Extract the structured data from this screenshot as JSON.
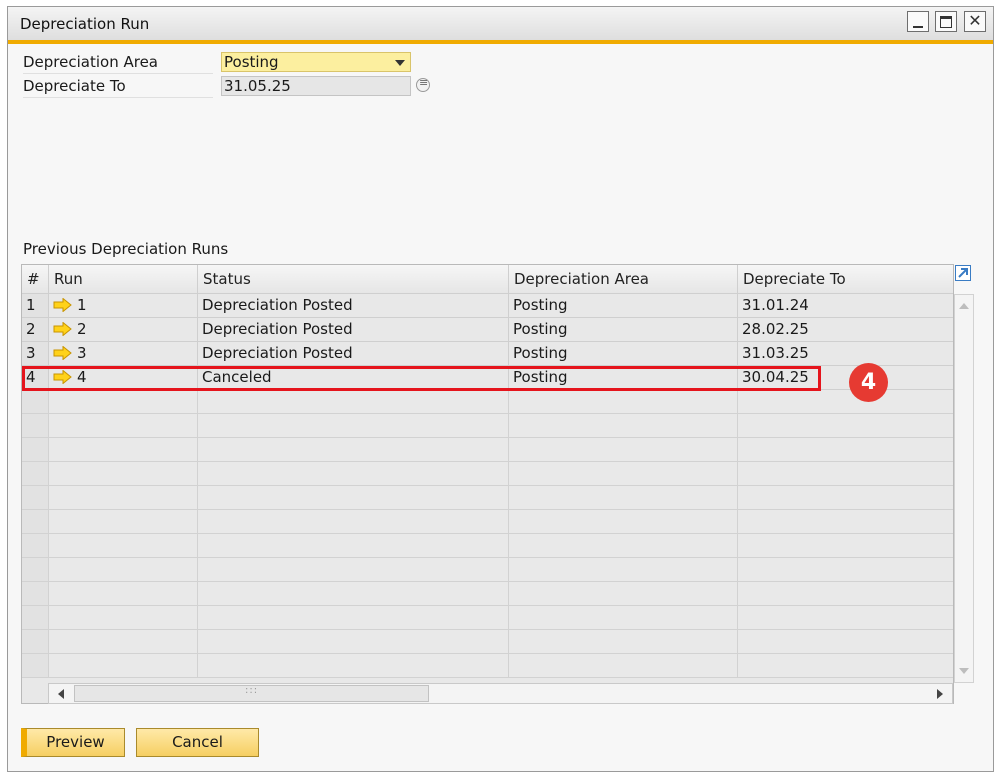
{
  "window": {
    "title": "Depreciation Run"
  },
  "form": {
    "area_label": "Depreciation Area",
    "area_value": "Posting",
    "to_label": "Depreciate To",
    "to_value": "31.05.25"
  },
  "grid": {
    "section_title": "Previous Depreciation Runs",
    "columns": [
      "#",
      "Run",
      "Status",
      "Depreciation Area",
      "Depreciate To"
    ],
    "rows": [
      {
        "num": "1",
        "run": "1",
        "status": "Depreciation Posted",
        "area": "Posting",
        "to": "31.01.24"
      },
      {
        "num": "2",
        "run": "2",
        "status": "Depreciation Posted",
        "area": "Posting",
        "to": "28.02.25"
      },
      {
        "num": "3",
        "run": "3",
        "status": "Depreciation Posted",
        "area": "Posting",
        "to": "31.03.25"
      },
      {
        "num": "4",
        "run": "4",
        "status": "Canceled",
        "area": "Posting",
        "to": "30.04.25"
      }
    ]
  },
  "buttons": {
    "preview": "Preview",
    "cancel": "Cancel"
  },
  "annotation": {
    "badge": "4",
    "color": "#e5141c"
  },
  "colors": {
    "accent": "#f0ab00",
    "field_highlight": "#fcef9f",
    "button": "#f6cf62"
  }
}
